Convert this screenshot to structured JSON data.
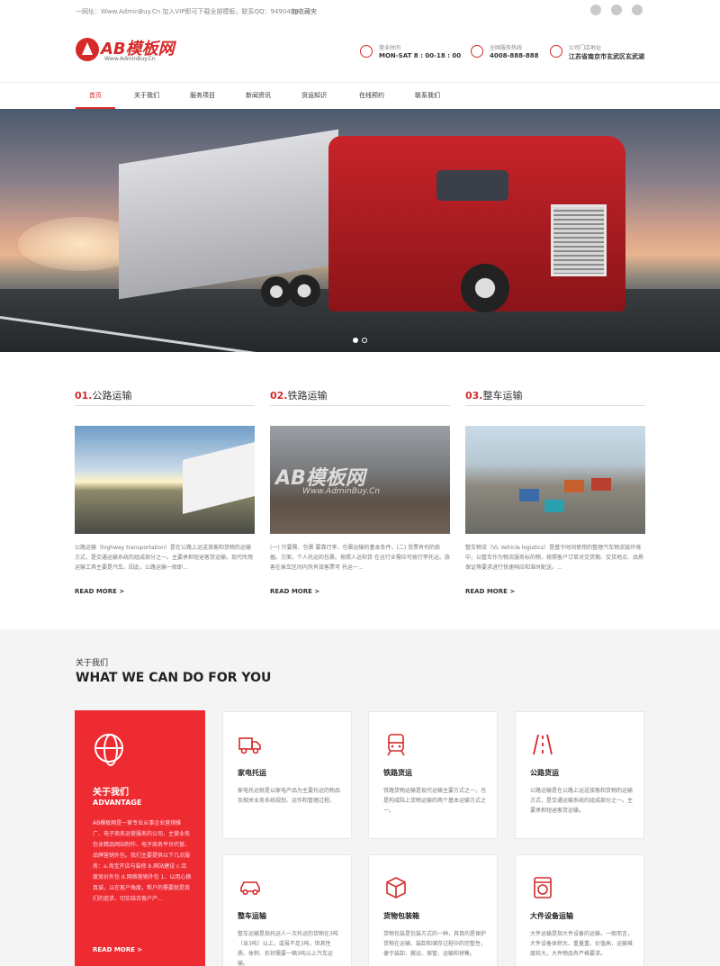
{
  "topbar": {
    "note": "一网址：Www.AdminBuy.Cn 加入VIP即可下载全部模板，联系QQ：9490489",
    "favorite": "加收藏夹",
    "icons": [
      "wechat-icon",
      "qq-icon",
      "weibo-icon"
    ]
  },
  "header": {
    "logo_name": "AB模板网",
    "logo_url": "Www.AdminBuy.Cn",
    "hours_label": "营业时间",
    "hours_value": "MON-SAT 8 : 00-18 : 00",
    "hotline_label": "全国服务热线",
    "hotline_value": "4008-888-888",
    "address_label": "公司门店地址",
    "address_value": "江苏省南京市玄武区玄武湖"
  },
  "nav": [
    "首页",
    "关于我们",
    "服务项目",
    "新闻资讯",
    "货运知识",
    "在线预约",
    "联系我们"
  ],
  "services": [
    {
      "num": "01.",
      "title": "公路运输",
      "desc": "公路运输（highway transportation）是在公路上运送旅客和货物的运输方式，是交通运输系统的组成部分之一。主要承担短途客货运输。现代所用运输工具主要是汽车。因此，公路运输一般即...",
      "more": "READ MORE >"
    },
    {
      "num": "02.",
      "title": "铁路运输",
      "desc": "(一) 只要需、包裹 要靠行李、包裹运输的基本条件。(二) 货票有何的依据。方面，个人托运的包裹。按照人运和货 在运行业需应可按行李托运。旅客在乘车区间内凭有效客票可 托运一...",
      "more": "READ MORE >"
    },
    {
      "num": "03.",
      "title": "整车运输",
      "desc": "整车物流（VL Vehicle logistics）是基于时间使用的整理汽车物流链环境中，以整车作为物流服务标的物，按照客户订单对交货期、交货地点、品质保证等要求进行快速响应和准时配送。...",
      "more": "READ MORE >"
    }
  ],
  "about": {
    "sub": "关于我们",
    "head": "WHAT WE CAN DO FOR YOU",
    "adv_title": "关于我们",
    "adv_sub": "ADVANTAGE",
    "adv_text": "AB模板网是一家专业从事企业营销推广、电子商务运营服务的公司，主营业务包含精品网站制作、电子商务平台代营、品牌营销外包。我们主要提供以下几点服务：a.淘宝开店与装修 b.网站建设 c.百度竞价外包 d.网络营销外包 1、以用心换真诚，以在客户角度，帮户的需要就是我们的追求，切实结合客户产...",
    "adv_more": "READ MORE >",
    "cards": [
      {
        "icon": "truck-icon",
        "title": "家电托运",
        "desc": "家电托运就是以家电产品为主要托运的物品及相关业务系统规划、运作和管理过程。"
      },
      {
        "icon": "train-icon",
        "title": "铁路货运",
        "desc": "铁路货物运输是现代运输主要方式之一，也是构成陆上货物运输的两个基本运输方式之一。"
      },
      {
        "icon": "road-icon",
        "title": "公路货运",
        "desc": "公路运输是在公路上运送旅客和货物的运输方式，是交通运输系统的组成部分之一。主要承担短途客货运输。"
      },
      {
        "icon": "car-icon",
        "title": "整车运输",
        "desc": "整车运输是指托运人一次托运的货物在3吨（含3吨）以上，或虽不足3吨，但其性质、体积、形状需要一辆3吨以上汽车运输。"
      },
      {
        "icon": "box-icon",
        "title": "货物包装箱",
        "desc": "货物包装是包装方式的一种，其目的是保护货物在运输、装卸和储存过程中的完整性，便于装卸、搬运、保管、运输和销售。"
      },
      {
        "icon": "washer-icon",
        "title": "大件设备运输",
        "desc": "大件运输是指大件设备的运输，一般而言，大件设备体积大、重量重、价值高，运输难度较大，大件物品有严格要求。"
      }
    ]
  },
  "colors": {
    "accent": "#d62a2a",
    "adv_bg": "#ed2b31"
  }
}
